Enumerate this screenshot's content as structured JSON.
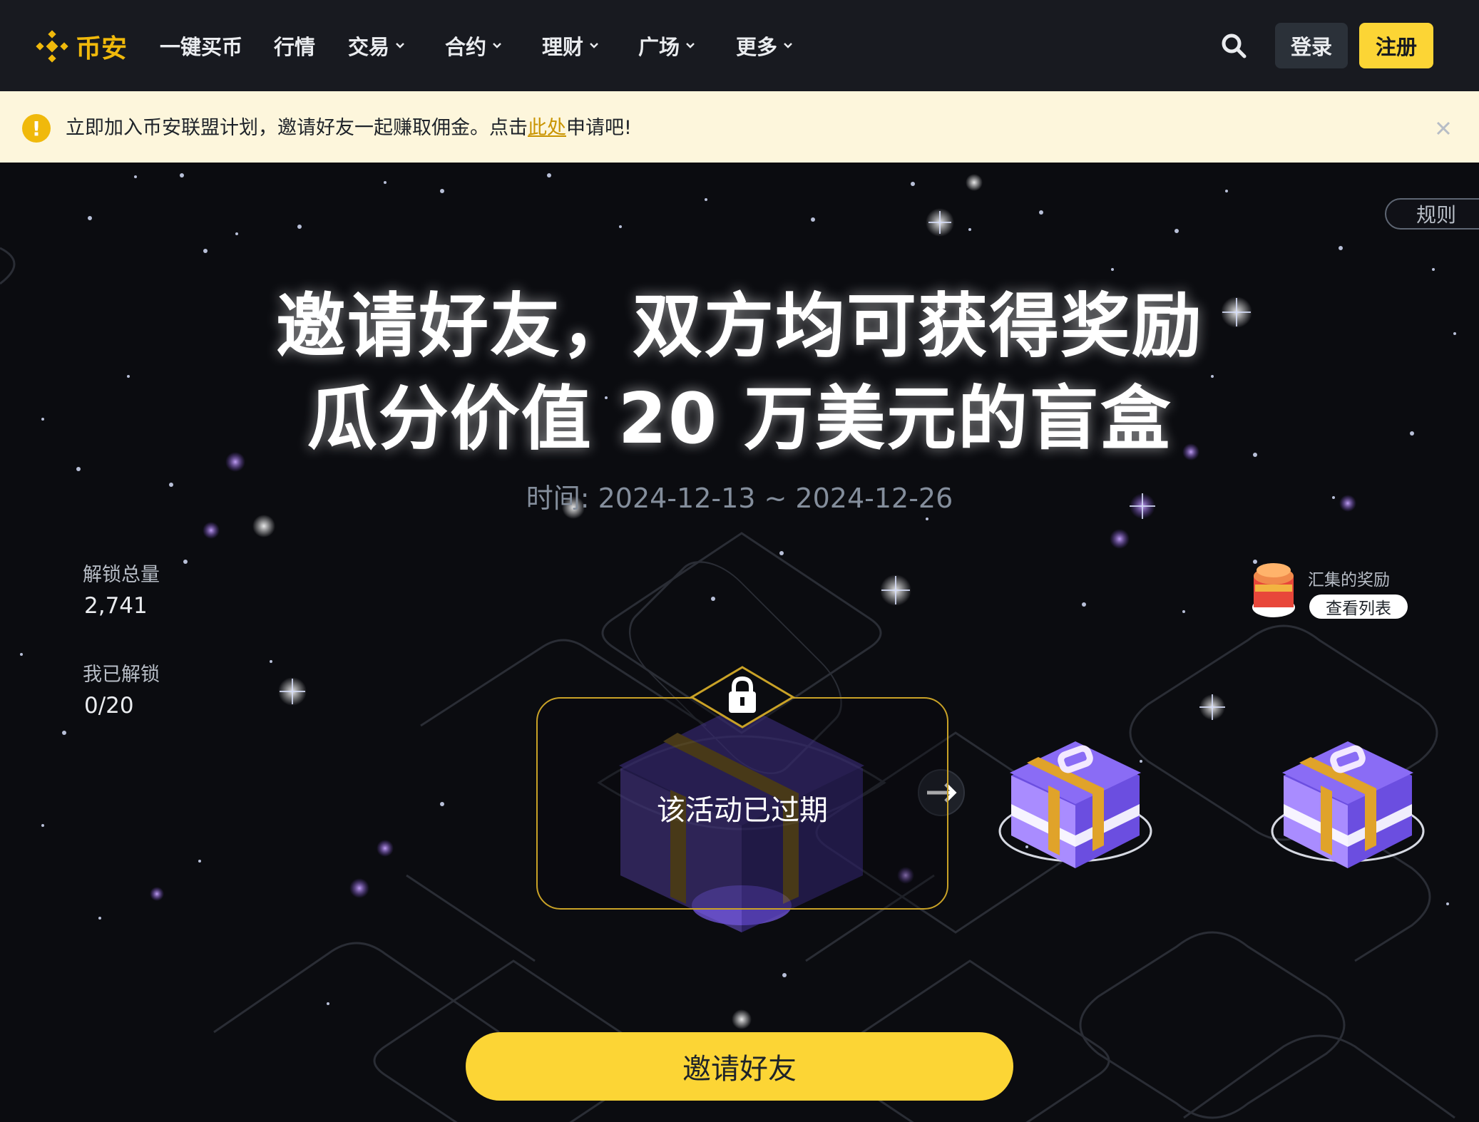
{
  "nav": {
    "logo_text": "币安",
    "items": [
      {
        "label": "一键买币",
        "dropdown": false
      },
      {
        "label": "行情",
        "dropdown": false
      },
      {
        "label": "交易",
        "dropdown": true
      },
      {
        "label": "合约",
        "dropdown": true
      },
      {
        "label": "理财",
        "dropdown": true
      },
      {
        "label": "广场",
        "dropdown": true
      },
      {
        "label": "更多",
        "dropdown": true
      }
    ],
    "login": "登录",
    "signup": "注册"
  },
  "banner": {
    "text_before": "立即加入币安联盟计划，邀请好友一起赚取佣金。点击",
    "link": "此处",
    "text_after": "申请吧!"
  },
  "hero": {
    "rules": "规则",
    "headline_line1": "邀请好友，双方均可获得奖励",
    "headline_line2": "瓜分价值 20 万美元的盲盒",
    "time_label": "时间: 2024-12-13 ~ 2024-12-26",
    "total_unlocked_label": "解锁总量",
    "total_unlocked_value": "2,741",
    "my_unlocked_label": "我已解锁",
    "my_unlocked_value": "0/20",
    "rewards_title": "汇集的奖励",
    "rewards_button": "查看列表",
    "expired_text": "该活动已过期",
    "invite_button": "邀请好友"
  },
  "colors": {
    "brand_yellow": "#fcd535",
    "binance_gold": "#f0b90b",
    "nav_bg": "#181a20",
    "banner_bg": "#fdf6dc",
    "gift_purple": "#7b5cf0"
  },
  "icons": [
    "binance-logo-icon",
    "chevron-down-icon",
    "search-icon",
    "warning-icon",
    "close-icon",
    "lock-icon",
    "arrow-right-icon",
    "gift-box-icon",
    "reward-stack-icon"
  ]
}
